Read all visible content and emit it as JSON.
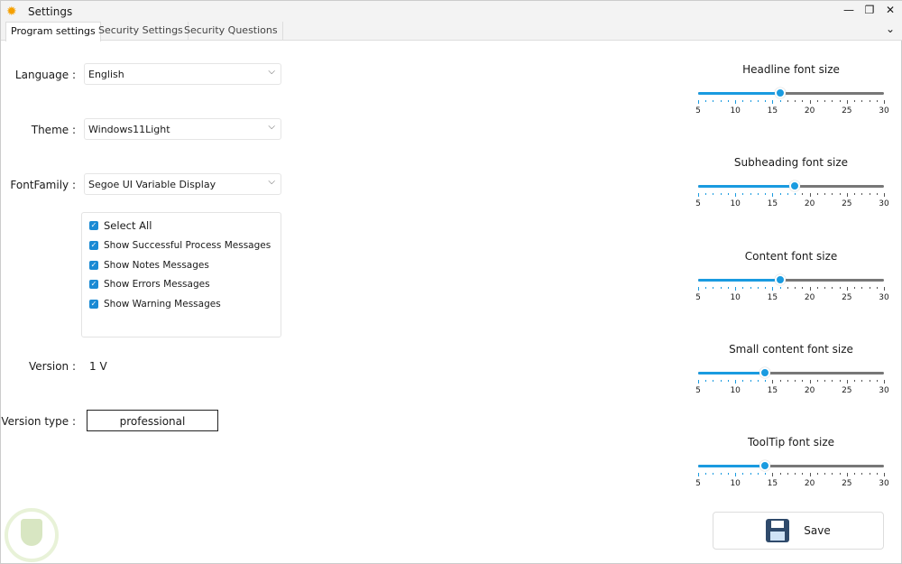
{
  "window": {
    "title": "Settings",
    "minimize": "—",
    "maximize": "❐",
    "close": "✕",
    "tabs_overflow": "⌄"
  },
  "tabs": [
    {
      "label": "Program settings"
    },
    {
      "label": "Security Settings"
    },
    {
      "label": "Security Questions"
    }
  ],
  "form": {
    "language_label": "Language :",
    "language_value": "English",
    "theme_label": "Theme :",
    "theme_value": "Windows11Light",
    "font_label": "FontFamily :",
    "font_value": "Segoe UI Variable Display",
    "checks": [
      "Select All",
      "Show Successful Process Messages",
      "Show Notes Messages",
      "Show Errors Messages",
      "Show Warning Messages"
    ],
    "version_label": "Version :",
    "version_value": "1 V",
    "version_type_label": "Version type :",
    "version_type_value": "professional"
  },
  "sliders": [
    {
      "title": "Headline font size",
      "value": 16,
      "min": 5,
      "max": 30
    },
    {
      "title": "Subheading font size",
      "value": 18,
      "min": 5,
      "max": 30
    },
    {
      "title": "Content font size",
      "value": 16,
      "min": 5,
      "max": 30
    },
    {
      "title": "Small content font size",
      "value": 14,
      "min": 5,
      "max": 30
    },
    {
      "title": "ToolTip font size",
      "value": 14,
      "min": 5,
      "max": 30
    }
  ],
  "tick_labels": [
    "5",
    "10",
    "15",
    "20",
    "25",
    "30"
  ],
  "save_label": "Save",
  "colors": {
    "accent": "#1a9be0"
  }
}
